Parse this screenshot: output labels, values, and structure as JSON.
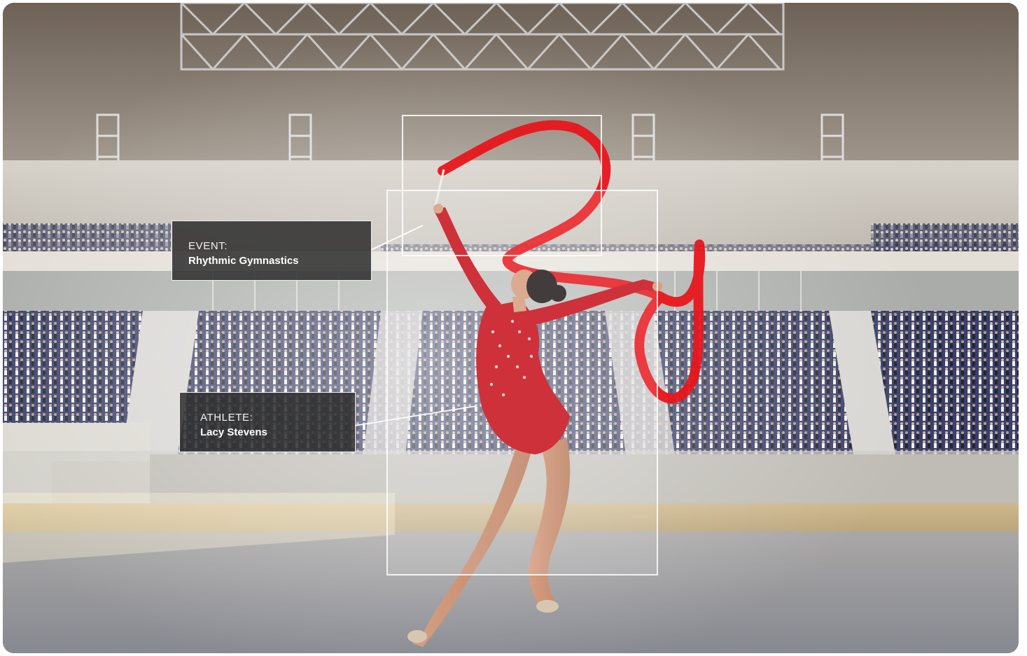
{
  "annotations": {
    "event": {
      "key": "EVENT:",
      "value": "Rhythmic Gymnastics"
    },
    "athlete": {
      "key": "ATHLETE:",
      "value": "Lacy Stevens"
    }
  },
  "colors": {
    "ribbon": "#e8161c",
    "leotard": "#c8151f",
    "label_bg": "#2d2d2d",
    "box_stroke": "#ffffff",
    "seat_blue": "#34407a"
  },
  "scene": {
    "subject": "gymnast-with-ribbon",
    "setting": "indoor-arena"
  }
}
